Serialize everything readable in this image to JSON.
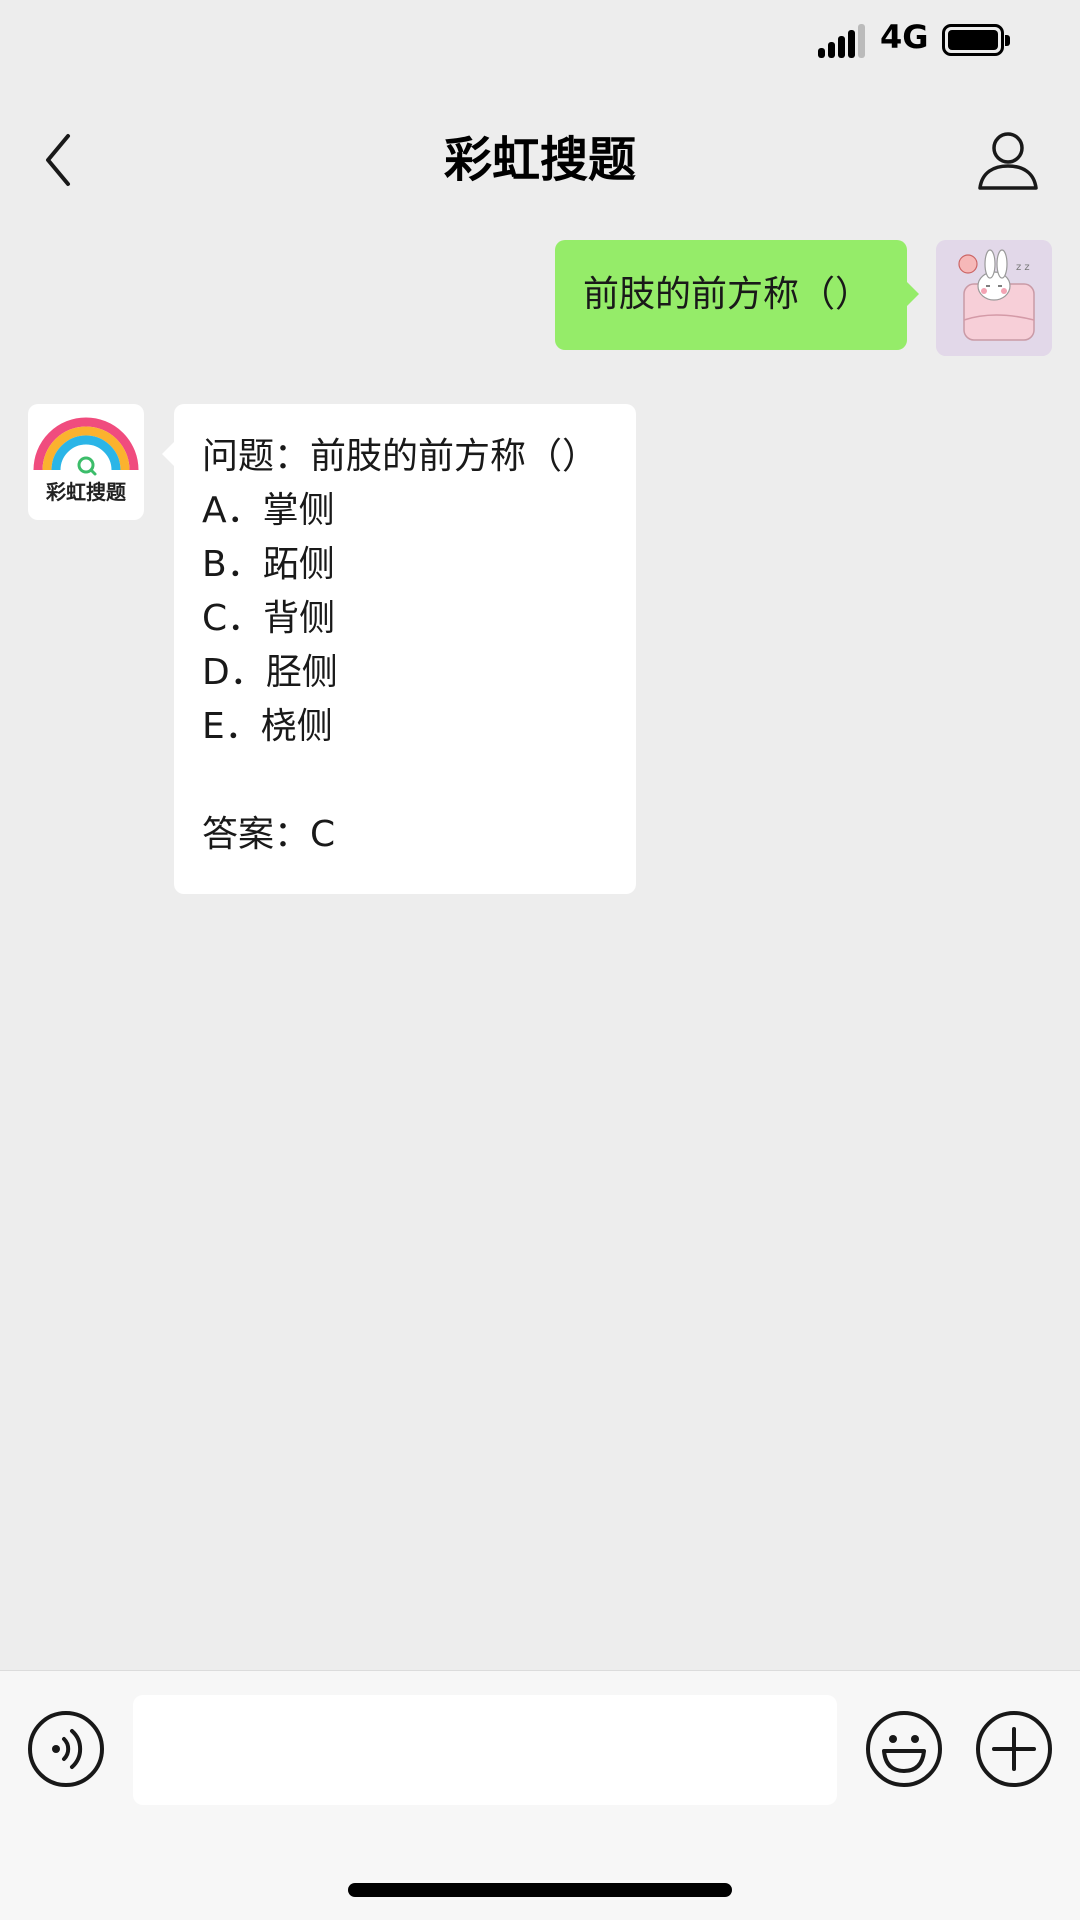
{
  "status_bar": {
    "network": "4G",
    "icons": [
      "signal-icon",
      "battery-icon"
    ]
  },
  "nav": {
    "title": "彩虹搜题",
    "icons": [
      "chevron-left-icon",
      "person-outline-icon"
    ]
  },
  "messages": {
    "user": {
      "text": "前肢的前方称（）",
      "avatar": "rabbit-sleeping-avatar"
    },
    "bot": {
      "avatar_label": "彩虹搜题",
      "avatar_icon": "rainbow-logo",
      "lines": [
        "问题：前肢的前方称（）",
        "A．掌侧",
        "B．跖侧",
        "C．背侧",
        "D．胫侧",
        "E．桡侧",
        "",
        "答案：C"
      ]
    }
  },
  "input_bar": {
    "text_value": "",
    "icons": [
      "voice-icon",
      "emoji-icon",
      "plus-icon"
    ]
  },
  "colors": {
    "background": "#ededed",
    "user_bubble": "#95ec69",
    "bot_bubble": "#ffffff",
    "input_bar": "#f7f7f7"
  }
}
